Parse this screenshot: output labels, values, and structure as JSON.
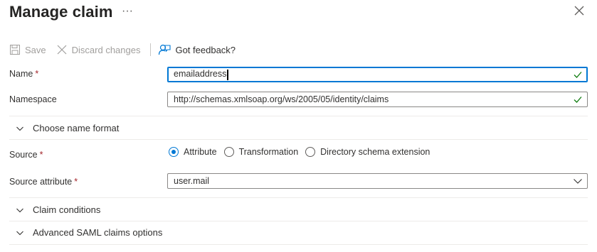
{
  "header": {
    "title": "Manage claim",
    "more_label": "···"
  },
  "toolbar": {
    "save_label": "Save",
    "discard_label": "Discard changes",
    "feedback_label": "Got feedback?"
  },
  "form": {
    "name": {
      "label": "Name",
      "required": "*",
      "value": "emailaddress",
      "valid": true
    },
    "namespace": {
      "label": "Namespace",
      "value": "http://schemas.xmlsoap.org/ws/2005/05/identity/claims",
      "valid": true
    },
    "name_format": {
      "label": "Choose name format",
      "expanded": false
    },
    "source": {
      "label": "Source",
      "required": "*",
      "options": [
        "Attribute",
        "Transformation",
        "Directory schema extension"
      ],
      "selected": "Attribute"
    },
    "source_attribute": {
      "label": "Source attribute",
      "required": "*",
      "value": "user.mail"
    },
    "claim_conditions": {
      "label": "Claim conditions",
      "expanded": false
    },
    "advanced_saml": {
      "label": "Advanced SAML claims options",
      "expanded": false
    }
  },
  "colors": {
    "accent": "#0078d4",
    "required": "#a4262c",
    "valid": "#107c10",
    "disabled": "#a19f9d"
  },
  "icons": [
    "close-icon",
    "save-icon",
    "discard-icon",
    "feedback-icon",
    "check-icon",
    "chevron-down-icon"
  ]
}
